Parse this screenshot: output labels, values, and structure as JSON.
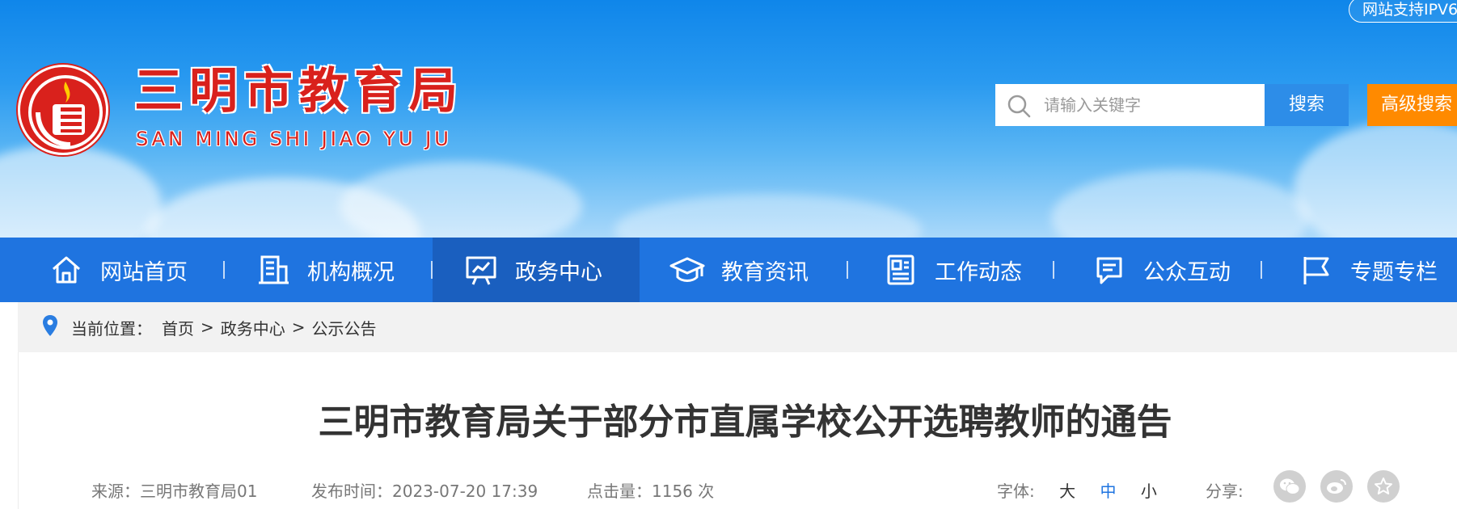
{
  "header": {
    "ipv6_badge": "网站支持IPV6",
    "site_title": "三明市教育局",
    "site_subtitle": "SAN MING SHI JIAO YU JU",
    "search": {
      "placeholder": "请输入关键字",
      "value": "",
      "button_label": "搜索",
      "advanced_label": "高级搜索"
    }
  },
  "nav": {
    "items": [
      {
        "label": "网站首页",
        "icon": "home-icon",
        "active": false
      },
      {
        "label": "机构概况",
        "icon": "building-icon",
        "active": false
      },
      {
        "label": "政务中心",
        "icon": "presentation-board-icon",
        "active": true
      },
      {
        "label": "教育资讯",
        "icon": "graduation-cap-icon",
        "active": false
      },
      {
        "label": "工作动态",
        "icon": "newspaper-icon",
        "active": false
      },
      {
        "label": "公众互动",
        "icon": "chat-bubble-icon",
        "active": false
      },
      {
        "label": "专题专栏",
        "icon": "flag-icon",
        "active": false
      }
    ]
  },
  "breadcrumb": {
    "prefix": "当前位置：",
    "items": [
      "首页",
      "政务中心",
      "公示公告"
    ],
    "separator": ">"
  },
  "article": {
    "title": "三明市教育局关于部分市直属学校公开选聘教师的通告",
    "source": "来源：三明市教育局01",
    "publish_time": "发布时间：2023-07-20 17:39",
    "views": "点击量：1156 次",
    "font_size": {
      "label": "字体:",
      "options": [
        "大",
        "中",
        "小"
      ],
      "current": "中"
    },
    "share_label": "分享:",
    "share_icons": [
      "wechat-icon",
      "weibo-icon",
      "favorite-star-icon"
    ]
  },
  "colors": {
    "nav_bg": "#1f74e0",
    "nav_active_bg": "#1a5fbf",
    "brand_red": "#d9211c",
    "search_button": "#2d8de8",
    "advanced_button": "#ff8a00",
    "link_blue": "#1f74e0"
  }
}
